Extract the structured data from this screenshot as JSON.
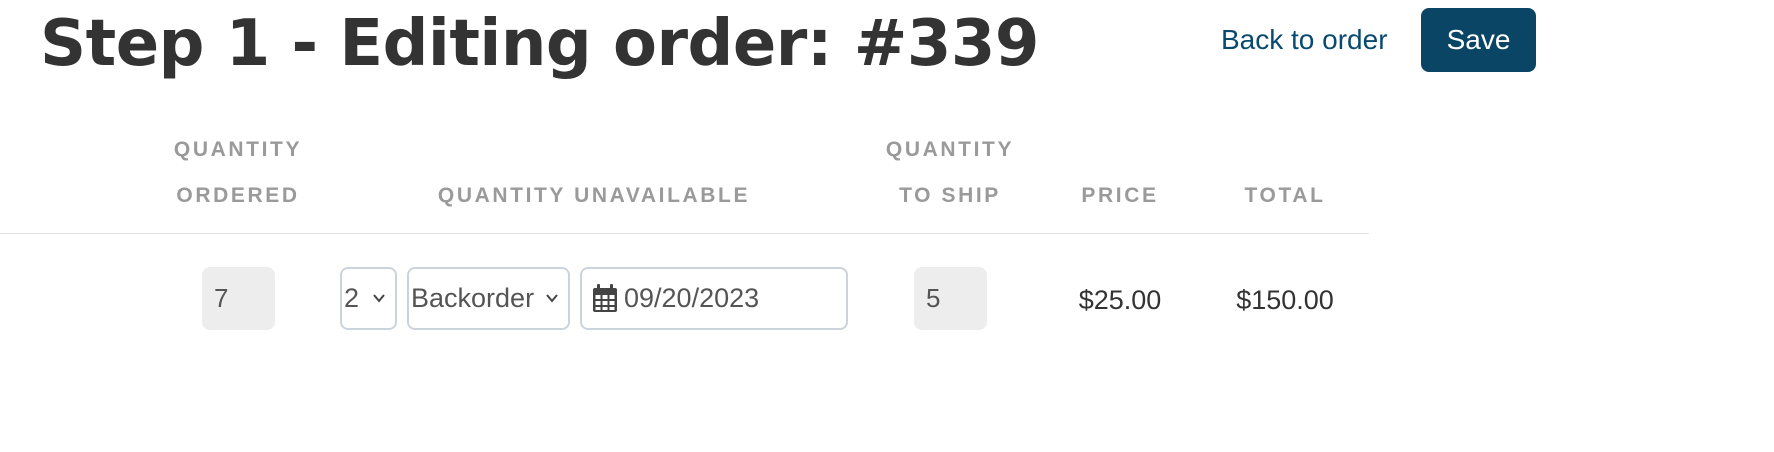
{
  "header": {
    "title": "Step 1 - Editing order: #339",
    "back_label": "Back to order",
    "save_label": "Save"
  },
  "table": {
    "headers": {
      "qty_ordered_line1": "QUANTITY",
      "qty_ordered_line2": "ORDERED",
      "qty_unavailable": "QUANTITY UNAVAILABLE",
      "qty_to_ship_line1": "QUANTITY",
      "qty_to_ship_line2": "TO SHIP",
      "price": "PRICE",
      "total": "TOTAL"
    },
    "row": {
      "qty_ordered": "7",
      "qty_unavailable_value": "2",
      "unavailable_status": "Backorder",
      "backorder_date": "09/20/2023",
      "qty_to_ship": "5",
      "price": "$25.00",
      "total": "$150.00"
    }
  },
  "icons": {
    "select_arrow": "chevron-down-icon",
    "date": "calendar-icon"
  },
  "colors": {
    "primary": "#0b4566",
    "link": "#0b4a6f",
    "header_text": "#9a9a9a",
    "readonly_bg": "#ededed",
    "input_border": "#cdd3da"
  }
}
